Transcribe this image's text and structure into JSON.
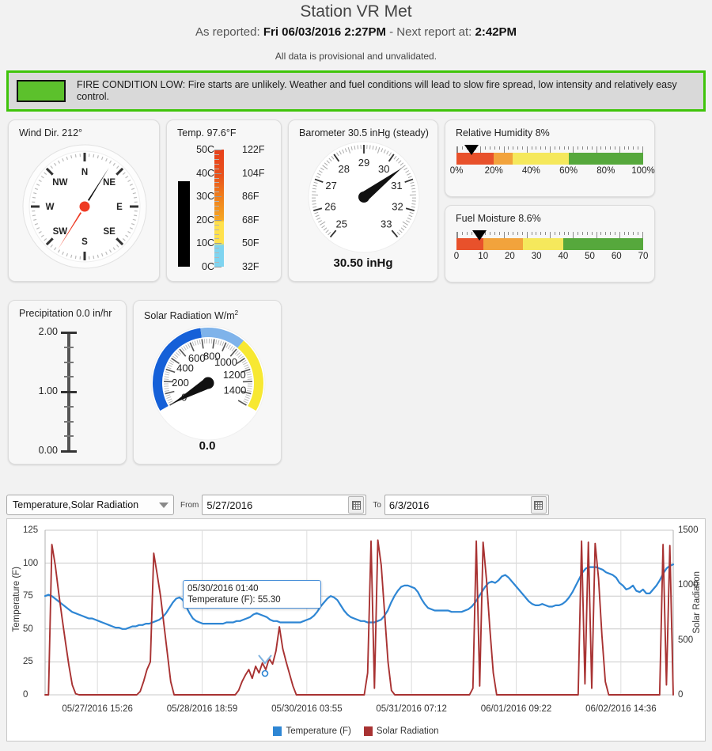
{
  "header": {
    "station_title": "Station VR Met",
    "as_reported_label": "As reported:",
    "as_reported_value": "Fri 06/03/2016 2:27PM",
    "separator": " - ",
    "next_report_label": "Next report at:",
    "next_report_value": "2:42PM",
    "provisional_note": "All data is provisional and unvalidated."
  },
  "fire_banner": {
    "swatch_color": "#5cc12c",
    "border_color": "#3fc40a",
    "text": "FIRE CONDITION LOW: Fire starts are unlikely. Weather and fuel conditions will lead to slow fire spread, low intensity and relatively easy control."
  },
  "wind": {
    "title": "Wind Dir. 212°",
    "degrees": 212,
    "compass_labels": [
      "N",
      "NE",
      "E",
      "SE",
      "S",
      "SW",
      "W",
      "NW"
    ],
    "needle_color": "#ee3b24",
    "tail_color": "#111111"
  },
  "temperature": {
    "title": "Temp. 97.6°F",
    "value_f": 97.6,
    "c_labels": [
      "50C",
      "40C",
      "30C",
      "20C",
      "10C",
      "0C"
    ],
    "f_labels": [
      "122F",
      "104F",
      "86F",
      "68F",
      "50F",
      "32F"
    ],
    "min_f": 32,
    "max_f": 122,
    "fill_color": "#000000"
  },
  "barometer": {
    "title": "Barometer 30.5 inHg (steady)",
    "value": 30.5,
    "readout": "30.50 inHg",
    "unit": "inHg",
    "trend": "steady",
    "min": 25,
    "max": 33,
    "ticks": [
      25,
      26,
      27,
      28,
      29,
      30,
      31,
      32,
      33
    ]
  },
  "humidity": {
    "title": "Relative Humidity 8%",
    "value": 8,
    "min": 0,
    "max": 100,
    "labels": [
      "0%",
      "20%",
      "40%",
      "60%",
      "80%",
      "100%"
    ],
    "label_values": [
      0,
      20,
      40,
      60,
      80,
      100
    ],
    "segments": [
      {
        "from": 0,
        "to": 20,
        "color": "#e8512b"
      },
      {
        "from": 20,
        "to": 30,
        "color": "#f2a33c"
      },
      {
        "from": 30,
        "to": 60,
        "color": "#f5e85c"
      },
      {
        "from": 60,
        "to": 100,
        "color": "#56a83c"
      }
    ]
  },
  "fuel_moisture": {
    "title": "Fuel Moisture 8.6%",
    "value": 8.6,
    "min": 0,
    "max": 70,
    "labels": [
      "0",
      "10",
      "20",
      "30",
      "40",
      "50",
      "60",
      "70"
    ],
    "label_values": [
      0,
      10,
      20,
      30,
      40,
      50,
      60,
      70
    ],
    "segments": [
      {
        "from": 0,
        "to": 10,
        "color": "#e8512b"
      },
      {
        "from": 10,
        "to": 25,
        "color": "#f2a33c"
      },
      {
        "from": 25,
        "to": 40,
        "color": "#f5e85c"
      },
      {
        "from": 40,
        "to": 70,
        "color": "#56a83c"
      }
    ]
  },
  "precipitation": {
    "title": "Precipitation 0.0 in/hr",
    "value": 0.0,
    "min": 0.0,
    "max": 2.0,
    "labels": [
      "2.00",
      "1.00",
      "0.00"
    ],
    "label_values": [
      2.0,
      1.0,
      0.0
    ]
  },
  "solar": {
    "title": "Solar Radiation W/m",
    "title_sup": "2",
    "value": 0.0,
    "readout": "0.0",
    "min": 0,
    "max": 1500,
    "ticks": [
      0,
      200,
      400,
      600,
      800,
      1000,
      1200,
      1400
    ],
    "bands": [
      {
        "from": 0,
        "to": 700,
        "color": "#1560d8"
      },
      {
        "from": 700,
        "to": 1000,
        "color": "#7fb3ea"
      },
      {
        "from": 1000,
        "to": 1500,
        "color": "#f7e832"
      }
    ]
  },
  "toolbar": {
    "series_select_value": "Temperature,Solar Radiation",
    "from_label": "From",
    "from_value": "5/27/2016",
    "to_label": "To",
    "to_value": "6/3/2016",
    "calendar_icon": "calendar-icon",
    "dropdown_icon": "chevron-down-icon"
  },
  "tooltip": {
    "timestamp": "05/30/2016 01:40",
    "reading": "Temperature (F): 55.30"
  },
  "chart_data": {
    "type": "line",
    "title": "",
    "xlabel": "",
    "ylabel": "Temperature (F)",
    "y2label": "Solar Radiation",
    "ylim": [
      0,
      125
    ],
    "y2lim": [
      0,
      1500
    ],
    "yticks": [
      0,
      25,
      50,
      75,
      100,
      125
    ],
    "y2ticks": [
      0,
      500,
      1000,
      1500
    ],
    "grid": true,
    "legend_position": "bottom",
    "xticks": [
      "05/27/2016 15:26",
      "05/28/2016 18:59",
      "05/30/2016 03:55",
      "05/31/2016 07:12",
      "06/01/2016 09:22",
      "06/02/2016 14:36"
    ],
    "series": [
      {
        "name": "Temperature (F)",
        "color": "#2e86d4",
        "axis": "left",
        "units": "F",
        "values": [
          75,
          76,
          75,
          73,
          71,
          69,
          67,
          65,
          63,
          62,
          61,
          60,
          59,
          58,
          58,
          57,
          56,
          55,
          54,
          53,
          52,
          51,
          51,
          50,
          50,
          51,
          52,
          52,
          53,
          53,
          54,
          54,
          55,
          56,
          57,
          59,
          62,
          66,
          70,
          73,
          74,
          72,
          67,
          62,
          58,
          56,
          55,
          54,
          54,
          54,
          54,
          54,
          54,
          54,
          55,
          55,
          55,
          56,
          56,
          57,
          58,
          59,
          61,
          62,
          61,
          60,
          59,
          57,
          56,
          56,
          55,
          55,
          55,
          55,
          55,
          55,
          55,
          56,
          57,
          58,
          60,
          63,
          67,
          70,
          73,
          75,
          74,
          72,
          68,
          64,
          61,
          59,
          58,
          57,
          56,
          56,
          55,
          55,
          55,
          56,
          57,
          60,
          64,
          70,
          75,
          79,
          82,
          83,
          83,
          82,
          81,
          78,
          73,
          69,
          66,
          65,
          64,
          64,
          64,
          64,
          64,
          63,
          63,
          63,
          63,
          64,
          65,
          67,
          70,
          74,
          78,
          82,
          85,
          86,
          85,
          87,
          90,
          91,
          89,
          86,
          83,
          80,
          77,
          74,
          71,
          69,
          68,
          68,
          69,
          68,
          67,
          67,
          68,
          68,
          69,
          71,
          74,
          78,
          83,
          88,
          93,
          96,
          97,
          97,
          97,
          96,
          95,
          93,
          92,
          91,
          89,
          85,
          83,
          80,
          81,
          83,
          79,
          78,
          80,
          77,
          77,
          80,
          83,
          87,
          92,
          96,
          98,
          99
        ]
      },
      {
        "name": "Solar Radiation",
        "color": "#a83232",
        "axis": "right",
        "units": "W/m2",
        "values": [
          0,
          0,
          1370,
          1180,
          930,
          700,
          480,
          270,
          90,
          10,
          0,
          0,
          0,
          0,
          0,
          0,
          0,
          0,
          0,
          0,
          0,
          0,
          0,
          0,
          0,
          0,
          0,
          0,
          30,
          120,
          230,
          300,
          1290,
          1100,
          900,
          640,
          380,
          120,
          0,
          0,
          0,
          0,
          0,
          0,
          0,
          0,
          0,
          0,
          0,
          0,
          0,
          0,
          0,
          0,
          0,
          0,
          0,
          40,
          120,
          180,
          230,
          150,
          260,
          200,
          290,
          230,
          330,
          280,
          400,
          620,
          420,
          300,
          190,
          80,
          0,
          0,
          0,
          0,
          0,
          0,
          0,
          0,
          0,
          0,
          0,
          0,
          0,
          0,
          0,
          0,
          0,
          0,
          0,
          0,
          0,
          200,
          1400,
          60,
          1410,
          1180,
          740,
          300,
          40,
          0,
          0,
          0,
          0,
          0,
          0,
          0,
          0,
          0,
          0,
          0,
          0,
          0,
          0,
          0,
          0,
          0,
          0,
          0,
          0,
          0,
          0,
          0,
          60,
          1400,
          80,
          1390,
          1050,
          600,
          200,
          0,
          0,
          0,
          0,
          0,
          0,
          0,
          0,
          0,
          0,
          0,
          0,
          0,
          0,
          0,
          0,
          0,
          0,
          0,
          0,
          0,
          0,
          0,
          0,
          0,
          1400,
          100,
          1390,
          60,
          1380,
          1060,
          540,
          120,
          0,
          0,
          0,
          0,
          0,
          0,
          0,
          0,
          0,
          0,
          0,
          0,
          0,
          0,
          0,
          0,
          1370,
          90,
          1360,
          0
        ]
      }
    ]
  }
}
